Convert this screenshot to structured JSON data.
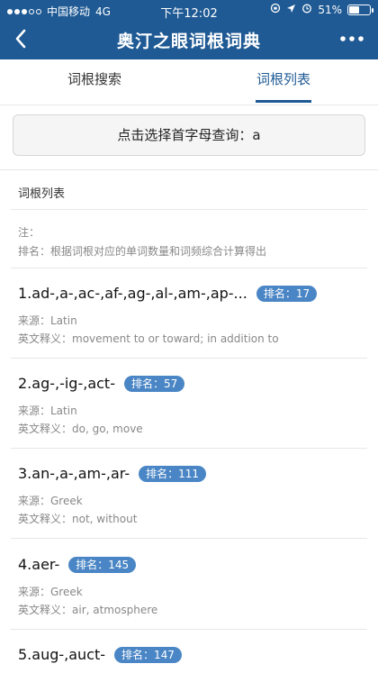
{
  "status": {
    "carrier": "中国移动",
    "network": "4G",
    "time": "下午12:02",
    "battery": "51%",
    "battery_level": 0.51
  },
  "nav": {
    "title": "奥汀之眼词根词典"
  },
  "tabs": [
    {
      "label": "词根搜索",
      "active": false
    },
    {
      "label": "词根列表",
      "active": true
    }
  ],
  "search": {
    "prompt": "点击选择首字母查询：a"
  },
  "list_title": "词根列表",
  "note": {
    "line1": "注：",
    "line2": "排名：根据词根对应的单词数量和词频综合计算得出"
  },
  "items": [
    {
      "name": "1.ad-,a-,ac-,af-,ag-,al-,am-,ap-...",
      "badge": "排名：17",
      "source": "来源：Latin",
      "meaning": "英文释义：movement to or toward; in addition to"
    },
    {
      "name": "2.ag-,-ig-,act-",
      "badge": "排名：57",
      "source": "来源：Latin",
      "meaning": "英文释义：do, go, move"
    },
    {
      "name": "3.an-,a-,am-,ar-",
      "badge": "排名：111",
      "source": "来源：Greek",
      "meaning": "英文释义：not, without"
    },
    {
      "name": "4.aer-",
      "badge": "排名：145",
      "source": "来源：Greek",
      "meaning": "英文释义：air, atmosphere"
    },
    {
      "name": "5.aug-,auct-",
      "badge": "排名：147",
      "source": "",
      "meaning": ""
    }
  ],
  "colors": {
    "brand": "#1f5a94",
    "badge": "#4a86c5"
  }
}
